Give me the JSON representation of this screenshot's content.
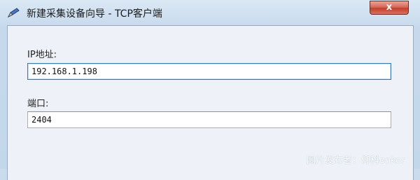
{
  "window": {
    "title": "新建采集设备向导 - TCP客户端",
    "close_label": "x"
  },
  "form": {
    "ip_label": "IP地址:",
    "ip_value": "192.168.1.198",
    "port_label": "端口:",
    "port_value": "2404"
  },
  "watermark": "图片发布者：仰科onker",
  "icons": {
    "app": "wizard-pencil-icon",
    "close": "close-icon"
  }
}
